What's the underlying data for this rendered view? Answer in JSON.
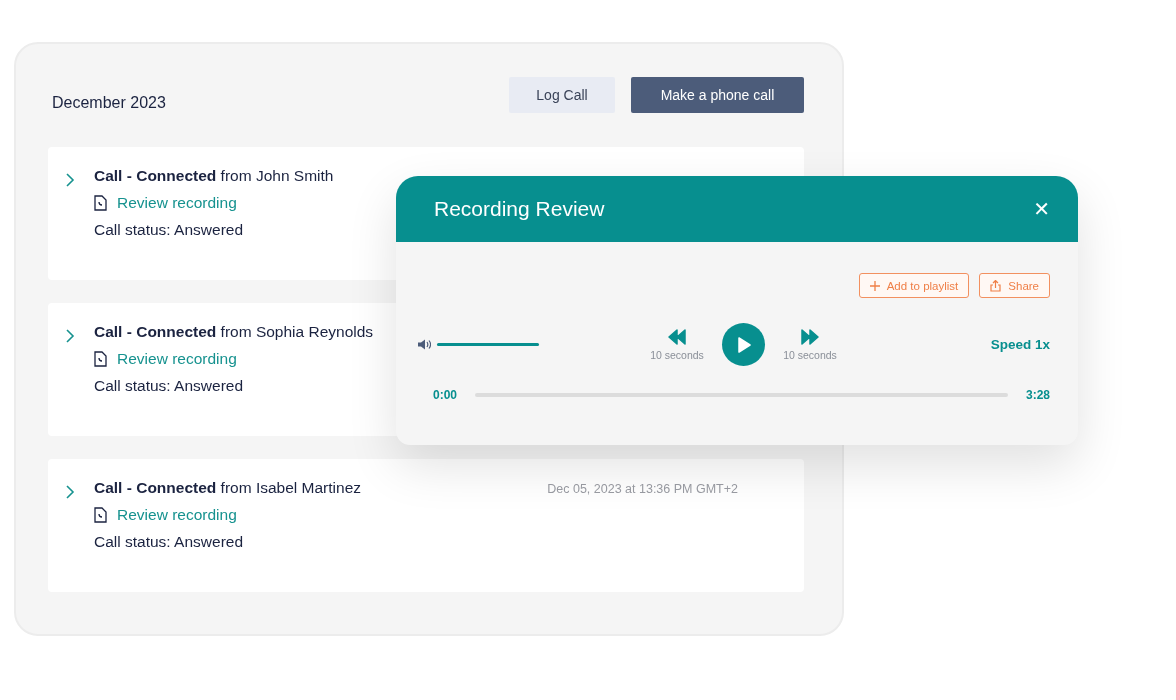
{
  "panel": {
    "month": "December 2023",
    "buttons": [
      {
        "label": "Log Call",
        "kind": "secondary"
      },
      {
        "label": "Make a phone call",
        "kind": "primary"
      }
    ],
    "calls": [
      {
        "type": "Call - Connected",
        "from": "from John Smith",
        "link": "Review recording",
        "status": "Call status: Answered"
      },
      {
        "type": "Call - Connected",
        "from": "from Sophia Reynolds",
        "link": "Review recording",
        "status": "Call status: Answered"
      },
      {
        "type": "Call - Connected",
        "from": "from Isabel Martinez",
        "link": "Review recording",
        "status": "Call status: Answered",
        "date": "Dec 05, 2023 at 13:36 PM GMT+2"
      }
    ]
  },
  "modal": {
    "title": "Recording Review",
    "close": "✕",
    "actions": [
      {
        "label": "Add to playlist",
        "kind": "add"
      },
      {
        "label": "Share",
        "kind": "share"
      }
    ],
    "volume": {
      "level": 1.0
    },
    "rewind": "10 seconds",
    "forward": "10 seconds",
    "speed": "Speed 1x",
    "progress": {
      "current": "0:00",
      "total": "3:28",
      "level": 0
    }
  }
}
